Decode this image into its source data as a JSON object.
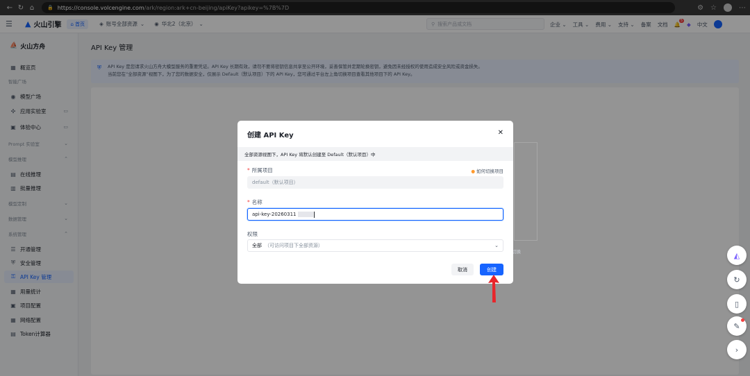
{
  "browser": {
    "url_host": "https://console.volcengine.com",
    "url_rest": "/ark/region:ark+cn-beijing/apiKey?apikey=%7B%7D"
  },
  "topnav": {
    "logo": "火山引擎",
    "home": "首页",
    "account": "账号全部资源",
    "region": "华北2（北京）",
    "search_placeholder": "搜索产品或文档",
    "menu": [
      "企业",
      "工具",
      "费用",
      "支持",
      "备案",
      "文档"
    ],
    "lang": "中文",
    "badge": "5"
  },
  "sidebar": {
    "brand": "火山方舟",
    "items": [
      {
        "label": "概览页",
        "icon": "dashboard-icon"
      },
      {
        "label": "模型广场",
        "icon": "model-icon"
      },
      {
        "label": "应用实验室",
        "icon": "lab-icon"
      },
      {
        "label": "体验中心",
        "icon": "experience-icon"
      },
      {
        "label": "在线推理",
        "icon": "inference-icon"
      },
      {
        "label": "批量推理",
        "icon": "batch-icon"
      },
      {
        "label": "开通管理",
        "icon": "activation-icon"
      },
      {
        "label": "安全管理",
        "icon": "security-icon"
      },
      {
        "label": "API Key 管理",
        "icon": "key-icon",
        "active": true
      },
      {
        "label": "用量统计",
        "icon": "stats-icon"
      },
      {
        "label": "项目配置",
        "icon": "project-icon"
      },
      {
        "label": "网络配置",
        "icon": "network-icon"
      },
      {
        "label": "Token计算器",
        "icon": "calculator-icon"
      }
    ],
    "sections": [
      "智能广场",
      "Prompt 实验室",
      "模型推理",
      "模型定制",
      "数据管理",
      "系统管理"
    ]
  },
  "main": {
    "title": "API Key 管理",
    "notice_line1": "API Key 是您请求火山方舟大模型服务的重要凭证。API Key 长期有效，请勿不要将密钥信息共享至公开环境，妥善保管并定期轮换密钥，避免因未经授权的使用造成安全风险或资金损失。",
    "notice_line2": "当前您在“全部资源”视图下，为了您的数据安全，仅展示 Default（默认项目）下的 API Key，您可通过平台左上角切换项目查看其他项目下的 API Key。",
    "bg_fragment": "切换"
  },
  "modal": {
    "title": "创建 API Key",
    "banner": "全部资源视图下，API Key 将默认创建至 Default（默认项目）中",
    "project_label": "所属项目",
    "help_link": "如何切换项目",
    "project_value": "default（默认项目）",
    "name_label": "名称",
    "name_value": "api-key-20260311",
    "perm_label": "权限",
    "perm_value": "全部",
    "perm_sub": "（可访问项目下全部资源）",
    "cancel": "取消",
    "create": "创建"
  },
  "colors": {
    "accent": "#1664ff",
    "required": "#f53f3f",
    "arrow": "#e8262b"
  }
}
